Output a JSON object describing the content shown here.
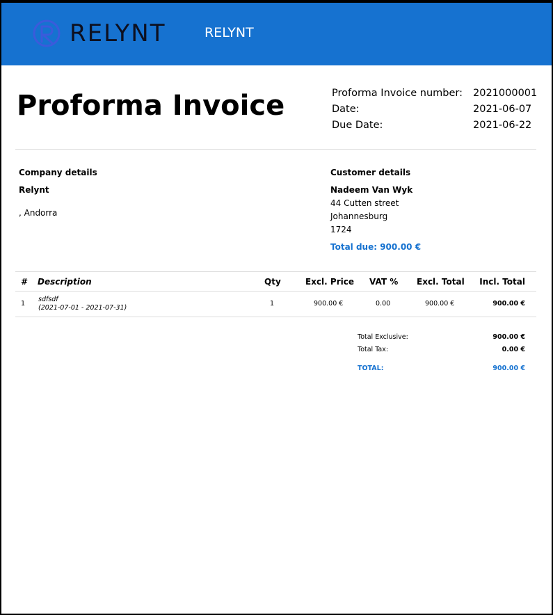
{
  "header": {
    "logo_text": "RELYNT",
    "company_name": "RELYNT",
    "colors": {
      "bar": "#1672d0",
      "logo_mark": "#3b5bdb"
    }
  },
  "document": {
    "title": "Proforma Invoice",
    "meta": [
      {
        "label": "Proforma Invoice number:",
        "value": "2021000001"
      },
      {
        "label": "Date:",
        "value": "2021-06-07"
      },
      {
        "label": "Due Date:",
        "value": "2021-06-22"
      }
    ]
  },
  "company": {
    "heading": "Company details",
    "name": "Relynt",
    "address_line": ", Andorra"
  },
  "customer": {
    "heading": "Customer details",
    "name": "Nadeem Van Wyk",
    "street": "44 Cutten street",
    "city": "Johannesburg",
    "postal": "1724",
    "total_due": "Total due: 900.00 €"
  },
  "table": {
    "headers": {
      "num": "#",
      "description": "Description",
      "qty": "Qty",
      "excl_price": "Excl. Price",
      "vat": "VAT %",
      "excl_total": "Excl. Total",
      "incl_total": "Incl. Total"
    },
    "rows": [
      {
        "num": "1",
        "description": "sdfsdf",
        "period": "(2021-07-01 - 2021-07-31)",
        "qty": "1",
        "excl_price": "900.00 €",
        "vat": "0.00",
        "excl_total": "900.00 €",
        "incl_total": "900.00 €"
      }
    ]
  },
  "totals": {
    "exclusive_label": "Total Exclusive:",
    "exclusive_value": "900.00 €",
    "tax_label": "Total Tax:",
    "tax_value": "0.00 €",
    "total_label": "TOTAL:",
    "total_value": "900.00 €"
  }
}
